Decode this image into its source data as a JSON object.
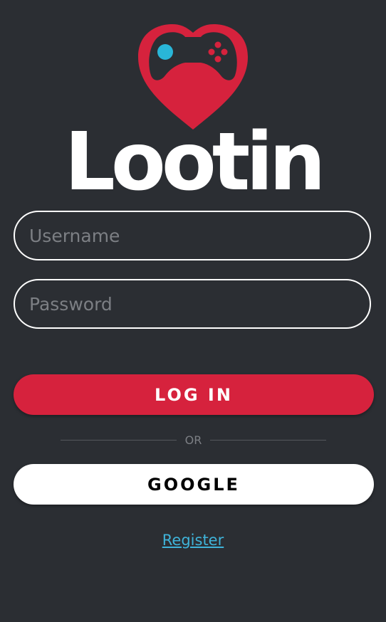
{
  "brand": {
    "name": "Lootin",
    "logo_icon": "heart-gamepad-icon",
    "accent_color": "#d6223d",
    "highlight_color": "#29b6d8"
  },
  "login_form": {
    "username_placeholder": "Username",
    "password_placeholder": "Password",
    "login_label": "LOG IN",
    "divider_label": "OR",
    "google_label": "GOOGLE",
    "register_label": "Register"
  },
  "theme": {
    "background": "#2b2e33",
    "field_border": "#ffffff",
    "link_color": "#3fb3d9"
  }
}
